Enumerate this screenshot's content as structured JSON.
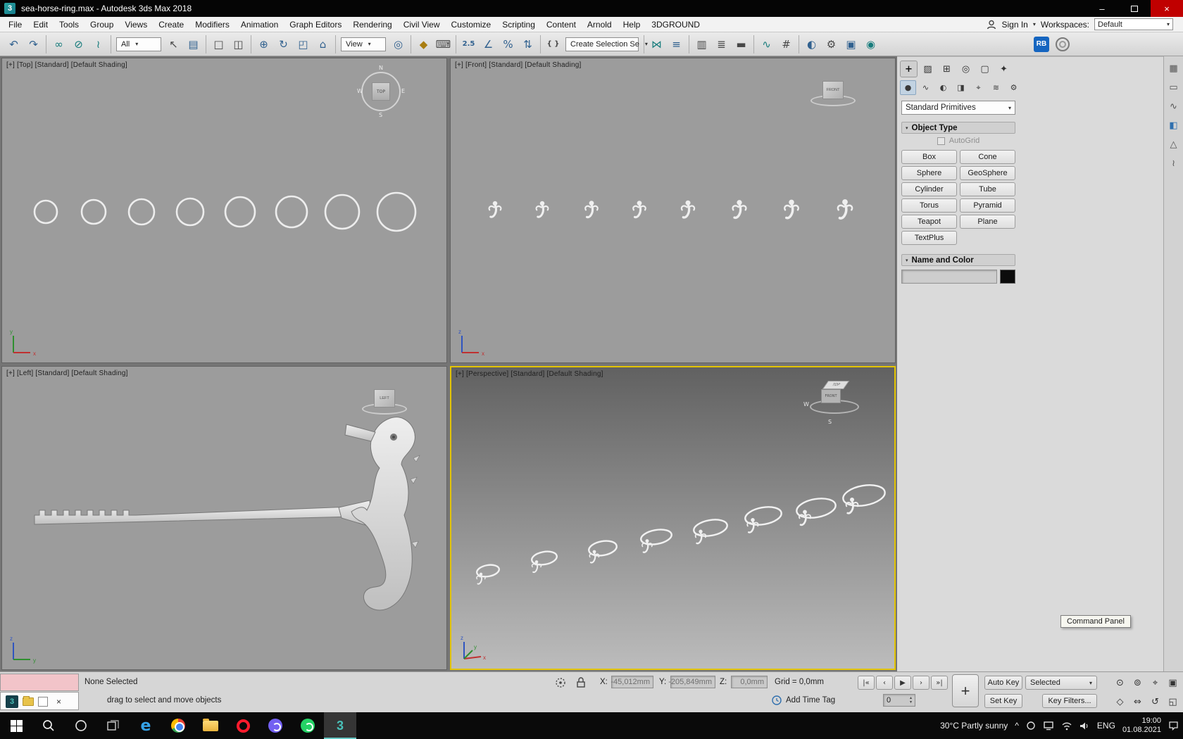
{
  "titlebar": {
    "app_glyph": "3",
    "title": "sea-horse-ring.max - Autodesk 3ds Max 2018",
    "minimize": "–",
    "close": "×"
  },
  "menubar": {
    "items": [
      "File",
      "Edit",
      "Tools",
      "Group",
      "Views",
      "Create",
      "Modifiers",
      "Animation",
      "Graph Editors",
      "Rendering",
      "Civil View",
      "Customize",
      "Scripting",
      "Content",
      "Arnold",
      "Help",
      "3DGROUND"
    ],
    "sign_in": "Sign In",
    "caret": "▾",
    "workspaces_label": "Workspaces:",
    "workspaces_value": "Default"
  },
  "toolbar": {
    "selection_filter": "All",
    "coord_system": "View",
    "selection_set": "Create Selection Se",
    "dd_arrow": "▾",
    "rb_badge": "RB",
    "icons": [
      {
        "name": "undo",
        "glyph": "↶"
      },
      {
        "name": "redo",
        "glyph": "↷"
      },
      {
        "name": "select-and-link",
        "glyph": "∞"
      },
      {
        "name": "unlink-selection",
        "glyph": "⊘"
      },
      {
        "name": "bind-to-space-warp",
        "glyph": "≀"
      },
      {
        "name": "select-object",
        "glyph": "↖"
      },
      {
        "name": "select-by-name",
        "glyph": "▤"
      },
      {
        "name": "rectangular-selection-region",
        "glyph": "□"
      },
      {
        "name": "window-crossing",
        "glyph": "◫"
      },
      {
        "name": "select-and-move",
        "glyph": "⊕"
      },
      {
        "name": "select-and-rotate",
        "glyph": "↻"
      },
      {
        "name": "select-and-scale",
        "glyph": "◰"
      },
      {
        "name": "select-and-place",
        "glyph": "⌂"
      },
      {
        "name": "use-pivot-point-center",
        "glyph": "◎"
      },
      {
        "name": "select-and-manipulate",
        "glyph": "◆"
      },
      {
        "name": "keyboard-shortcut-override",
        "glyph": "⌨"
      },
      {
        "name": "snaps-toggle",
        "glyph": "2.5"
      },
      {
        "name": "angle-snap",
        "glyph": "∠"
      },
      {
        "name": "percent-snap",
        "glyph": "%"
      },
      {
        "name": "spinner-snap",
        "glyph": "⇅"
      },
      {
        "name": "edit-named-selection-sets",
        "glyph": "{ }"
      },
      {
        "name": "mirror",
        "glyph": "⋈"
      },
      {
        "name": "align",
        "glyph": "≡"
      },
      {
        "name": "toggle-scene-explorer",
        "glyph": "▥"
      },
      {
        "name": "toggle-layer-explorer",
        "glyph": "≣"
      },
      {
        "name": "toggle-ribbon",
        "glyph": "▬"
      },
      {
        "name": "curve-editor",
        "glyph": "∿"
      },
      {
        "name": "schematic-view",
        "glyph": "#"
      },
      {
        "name": "material-editor",
        "glyph": "◐"
      },
      {
        "name": "render-setup",
        "glyph": "⚙"
      },
      {
        "name": "rendered-frame-window",
        "glyph": "▣"
      },
      {
        "name": "render-production",
        "glyph": "◉"
      }
    ]
  },
  "viewports": {
    "top": {
      "label": "[+] [Top] [Standard] [Default Shading]"
    },
    "front": {
      "label": "[+] [Front] [Standard] [Default Shading]"
    },
    "left": {
      "label": "[+] [Left] [Standard] [Default Shading]"
    },
    "perspective": {
      "label": "[+] [Perspective] [Standard] [Default Shading]"
    },
    "cube": {
      "top": "TOP",
      "front": "FRONT",
      "left": "LEFT",
      "n": "N",
      "e": "E",
      "s": "S",
      "w": "W"
    },
    "axes": {
      "x": "x",
      "y": "y",
      "z": "z"
    }
  },
  "command_panel": {
    "tabs": [
      {
        "name": "create",
        "glyph": "+"
      },
      {
        "name": "modify",
        "glyph": "▨"
      },
      {
        "name": "hierarchy",
        "glyph": "⊞"
      },
      {
        "name": "motion",
        "glyph": "◎"
      },
      {
        "name": "display",
        "glyph": "▢"
      },
      {
        "name": "utilities",
        "glyph": "✦"
      }
    ],
    "categories": [
      {
        "name": "geometry",
        "glyph": "●"
      },
      {
        "name": "shapes",
        "glyph": "∿"
      },
      {
        "name": "lights",
        "glyph": "◐"
      },
      {
        "name": "cameras",
        "glyph": "◨"
      },
      {
        "name": "helpers",
        "glyph": "⌖"
      },
      {
        "name": "space-warps",
        "glyph": "≋"
      },
      {
        "name": "systems",
        "glyph": "⚙"
      }
    ],
    "dropdown_value": "Standard Primitives",
    "rollout_marker": "▾",
    "object_type_title": "Object Type",
    "autogrid_label": "AutoGrid",
    "buttons": [
      "Box",
      "Cone",
      "Sphere",
      "GeoSphere",
      "Cylinder",
      "Tube",
      "Torus",
      "Pyramid",
      "Teapot",
      "Plane",
      "TextPlus"
    ],
    "name_color_title": "Name and Color"
  },
  "right_strip": {
    "icons": [
      {
        "name": "grid",
        "glyph": "▦"
      },
      {
        "name": "rectangle",
        "glyph": "▭"
      },
      {
        "name": "spline",
        "glyph": "∿"
      },
      {
        "name": "cube",
        "glyph": "◧"
      },
      {
        "name": "cone",
        "glyph": "△"
      },
      {
        "name": "link",
        "glyph": "≀"
      }
    ]
  },
  "tooltip": {
    "text": "Command Panel"
  },
  "statusbar": {
    "selection_status": "None Selected",
    "x_label": "X:",
    "x_value": "-45,012mm",
    "y_label": "Y:",
    "y_value": "-205,849mm",
    "z_label": "Z:",
    "z_value": "0,0mm",
    "grid_value": "Grid = 0,0mm",
    "playback": [
      "|«",
      "‹",
      "▶",
      "›",
      "»|"
    ],
    "key_plus": "+",
    "auto_key": "Auto Key",
    "set_key": "Set Key",
    "selected_value": "Selected",
    "key_filters": "Key Filters...",
    "add_time_tag": "Add Time Tag",
    "frame_value": "0",
    "spin_up": "▴",
    "spin_down": "▾",
    "prompt": "drag to select and move objects",
    "mini_max_glyph": "3",
    "mini_close": "×",
    "nav": [
      {
        "name": "zoom",
        "glyph": "⊙"
      },
      {
        "name": "zoom-all",
        "glyph": "⊚"
      },
      {
        "name": "zoom-extents",
        "glyph": "⌖"
      },
      {
        "name": "zoom-extents-all",
        "glyph": "▣"
      },
      {
        "name": "zoom-region",
        "glyph": "◇"
      },
      {
        "name": "pan",
        "glyph": "⇔"
      },
      {
        "name": "orbit",
        "glyph": "↺"
      },
      {
        "name": "maximize-viewport",
        "glyph": "◱"
      }
    ]
  },
  "taskbar": {
    "edge_glyph": "e",
    "opera_glyph": "O",
    "max_glyph": "3",
    "weather": "30°C  Partly sunny",
    "caret": "^",
    "lang": "ENG",
    "time": "19:00",
    "date": "01.08.2021"
  }
}
